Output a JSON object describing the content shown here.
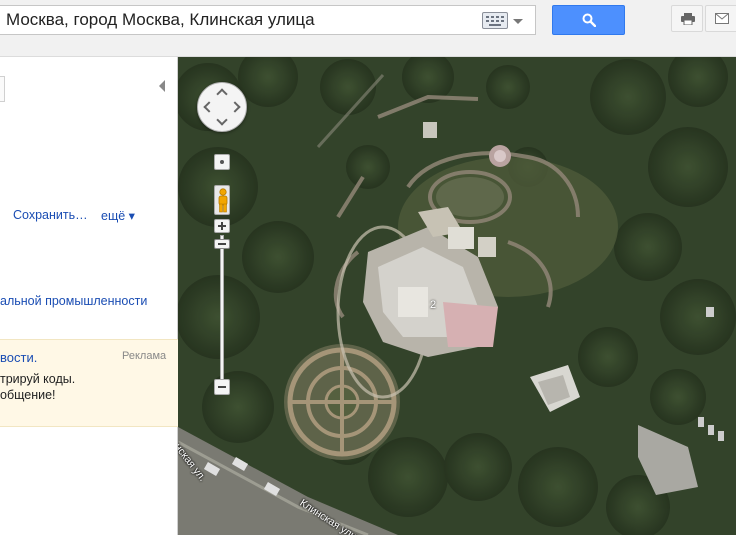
{
  "search": {
    "value": "Москва, город Москва, Клинская улица",
    "keyboard_icon": "keyboard-icon",
    "button_icon": "search-icon",
    "button_color": "#4d90fe"
  },
  "toolbar": {
    "print_icon": "print-icon",
    "mail_icon": "mail-icon"
  },
  "panel": {
    "save_label": "Сохранить…",
    "more_label": "ещё ▾",
    "category_link": "альной промышленности",
    "ad": {
      "title": "вости.",
      "label": "Реклама",
      "line1": "трируй коды.",
      "line2": "общение!"
    },
    "link_color": "#1a4db3",
    "ad_background": "#fff8e6"
  },
  "map": {
    "building_number": "2",
    "street_label_1": "Клинская ул.",
    "street_label_2": "Клинская улица"
  }
}
